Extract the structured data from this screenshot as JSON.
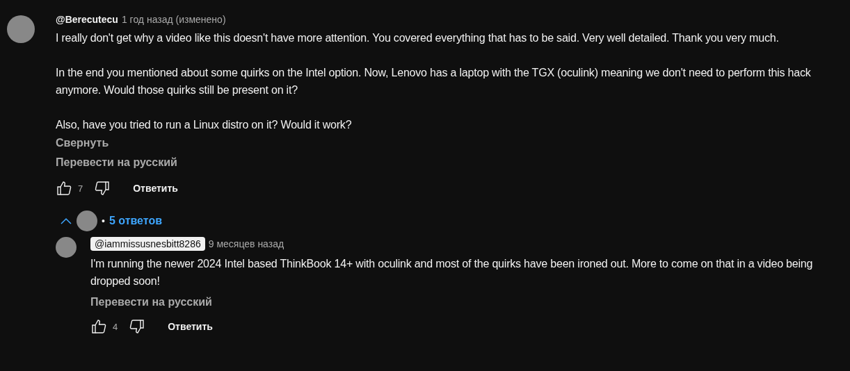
{
  "comment": {
    "author": "@Berecutecu",
    "time": "1 год назад (изменено)",
    "paragraphs": [
      "I really don't get why a video like this doesn't have more attention. You covered everything that has to be said. Very well detailed. Thank you very much.",
      "In the end you mentioned about some quirks on the Intel option. Now, Lenovo has a laptop with the TGX (oculink) meaning we don't need to perform this hack anymore. Would those quirks still be present on it?",
      "Also, have you tried to run a Linux distro on it? Would it work?"
    ],
    "collapse": "Свернуть",
    "translate": "Перевести на русский",
    "likes": "7",
    "reply_button": "Ответить"
  },
  "replies_toggle": {
    "expanded": true,
    "dot": "•",
    "count": "5 ответов"
  },
  "replies": [
    {
      "author": "@iammissusnesbitt8286",
      "author_highlighted": true,
      "time": "9 месяцев назад",
      "paragraphs": [
        "I'm running the newer 2024 Intel based ThinkBook 14+ with oculink and most of the quirks have been ironed out. More to come on that in a video being dropped soon!"
      ],
      "translate": "Перевести на русский",
      "likes": "4",
      "reply_button": "Ответить"
    }
  ]
}
